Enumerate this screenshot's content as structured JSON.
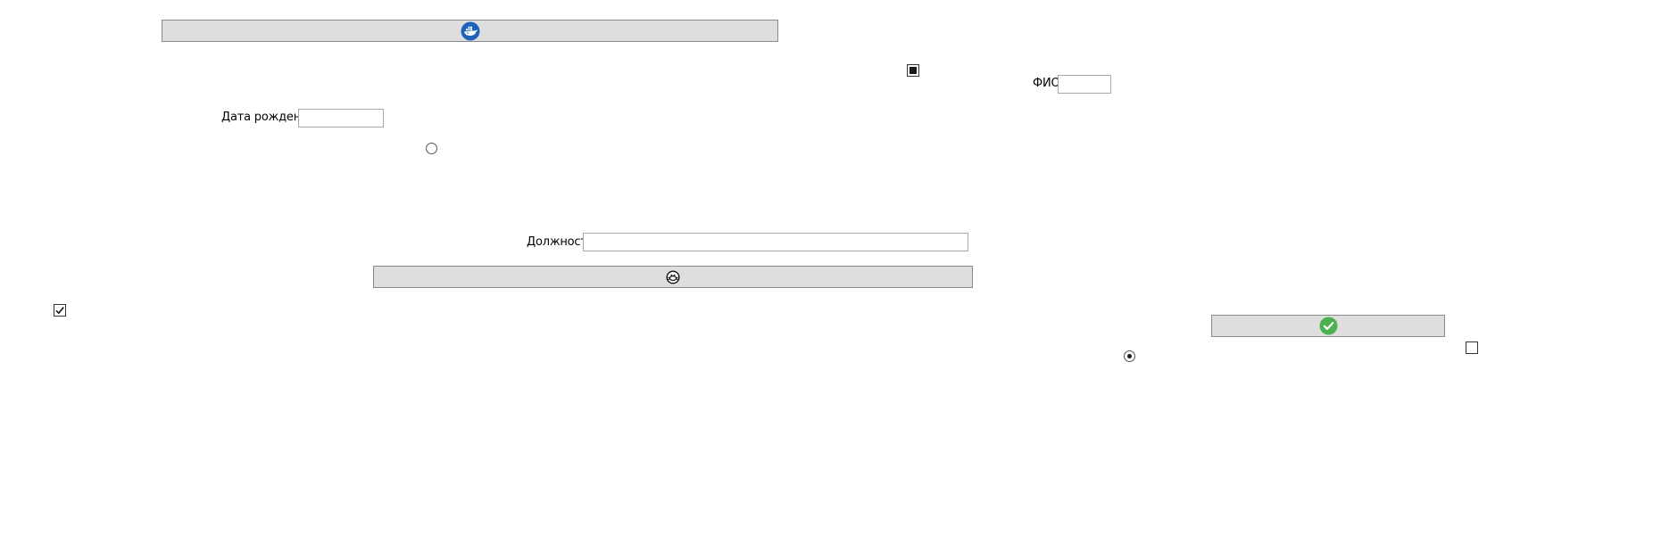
{
  "form": {
    "buttons": [
      {
        "icon": "docker-whale-icon",
        "icon_color": "#1d63b8"
      },
      {
        "icon": "crab-icon",
        "icon_color": "#111111"
      },
      {
        "icon": "green-checkmark-icon",
        "icon_color": "#4caf50"
      }
    ],
    "fio_label": "ФИО",
    "fio_value": "",
    "birthdate_label": "Дата рождения",
    "birthdate_value": "",
    "position_label": "Должность",
    "position_value": "",
    "checkboxes": [
      {
        "state": "indeterminate"
      },
      {
        "state": "checked"
      },
      {
        "state": "unchecked"
      }
    ],
    "radios": [
      {
        "selected": false
      },
      {
        "selected": true
      }
    ]
  },
  "colors": {
    "button_bg": "#dedede",
    "button_border": "#8a8a8a",
    "field_border": "#a8a8a8"
  }
}
